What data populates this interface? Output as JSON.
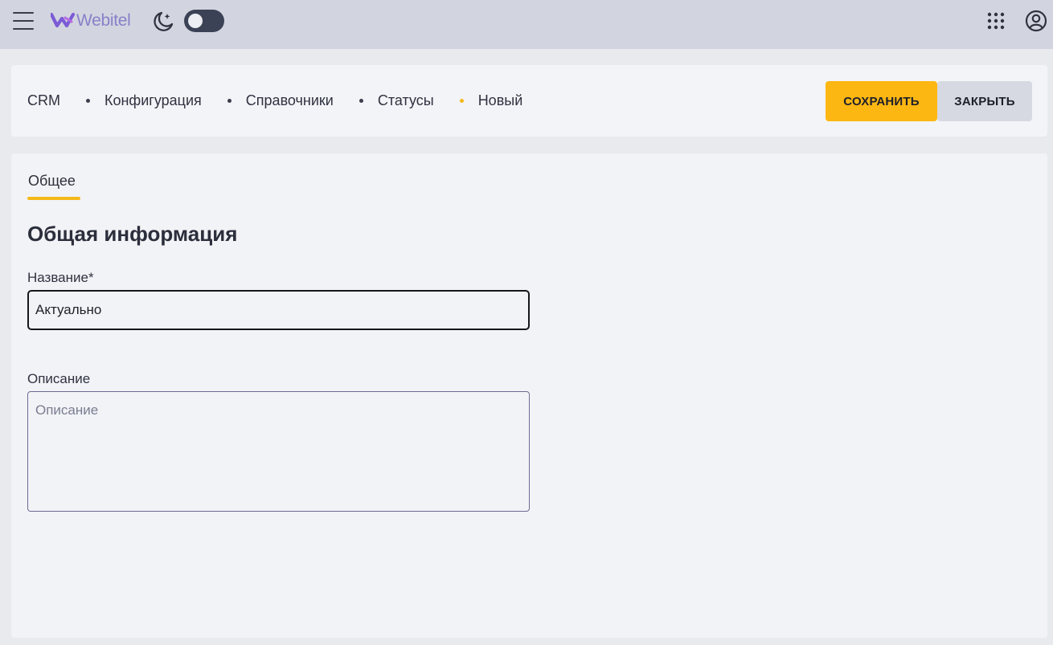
{
  "app": {
    "logo_text": "Webitel"
  },
  "breadcrumb": {
    "items": [
      "CRM",
      "Конфигурация",
      "Справочники",
      "Статусы",
      "Новый"
    ]
  },
  "actions": {
    "save_label": "СОХРАНИТЬ",
    "close_label": "ЗАКРЫТЬ"
  },
  "tabs": [
    {
      "label": "Общее",
      "active": true
    }
  ],
  "form": {
    "section_title": "Общая информация",
    "name": {
      "label": "Название*",
      "value": "Актуально"
    },
    "description": {
      "label": "Описание",
      "placeholder": "Описание",
      "value": ""
    }
  },
  "theme": {
    "accent": "#fdb713",
    "topbar_bg": "#d2d5df",
    "dark_mode_enabled": false
  },
  "icons": {
    "menu": "hamburger-menu-icon",
    "theme": "moon-stars-icon",
    "apps": "apps-grid-icon",
    "account": "user-account-icon"
  }
}
